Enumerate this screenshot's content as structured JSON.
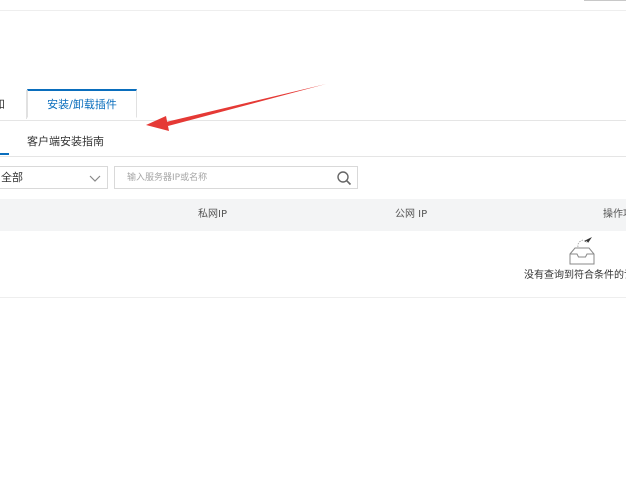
{
  "tabs": {
    "items": [
      {
        "label": "和",
        "active": false
      },
      {
        "label": "安装/卸载插件",
        "active": true
      }
    ]
  },
  "subtabs": {
    "items": [
      {
        "label": "客户端安装指南",
        "active": false
      }
    ]
  },
  "filters": {
    "select_value": "全部",
    "search_placeholder": "输入服务器IP或名称",
    "search_value": ""
  },
  "table": {
    "columns": [
      "私网IP",
      "公网 IP",
      "操作项"
    ],
    "rows": [],
    "empty_text": "没有查询到符合条件的记录"
  },
  "colors": {
    "accent": "#0a6ebd",
    "annotation": "#e53935"
  },
  "icons": {
    "select_chevron": "chevron-down-icon",
    "search": "search-icon",
    "empty": "empty-box-icon"
  }
}
